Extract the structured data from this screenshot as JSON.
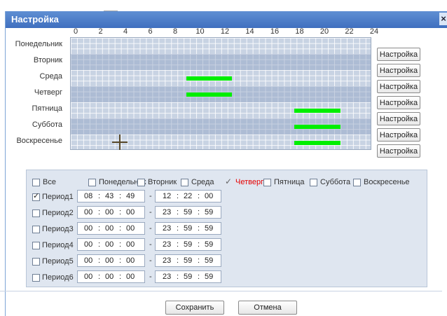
{
  "dialog": {
    "title": "Настройка",
    "close_symbol": "×"
  },
  "hours": [
    "0",
    "2",
    "4",
    "6",
    "8",
    "10",
    "12",
    "14",
    "16",
    "18",
    "20",
    "22",
    "24"
  ],
  "days": [
    {
      "label": "Понедельник",
      "button": "Настройка",
      "bars": []
    },
    {
      "label": "Вторник",
      "button": "Настройка",
      "bars": []
    },
    {
      "label": "Среда",
      "button": "Настройка",
      "bars": [
        {
          "start": 9.25,
          "end": 12.9
        }
      ]
    },
    {
      "label": "Четверг",
      "button": "Настройка",
      "bars": [
        {
          "start": 9.25,
          "end": 12.9
        }
      ]
    },
    {
      "label": "Пятница",
      "button": "Настройка",
      "bars": [
        {
          "start": 17.9,
          "end": 21.6
        }
      ]
    },
    {
      "label": "Суббота",
      "button": "Настройка",
      "bars": [
        {
          "start": 17.9,
          "end": 21.6
        }
      ]
    },
    {
      "label": "Воскресенье",
      "button": "Настройка",
      "bars": [
        {
          "start": 17.9,
          "end": 21.6
        }
      ]
    }
  ],
  "day_checks": [
    {
      "label": "Все",
      "checked": false
    },
    {
      "label": "Понедельник",
      "checked": false
    },
    {
      "label": "Вторник",
      "checked": false
    },
    {
      "label": "Среда",
      "checked": false
    },
    {
      "label": "Четверг",
      "checked": true
    },
    {
      "label": "Пятница",
      "checked": false
    },
    {
      "label": "Суббота",
      "checked": false
    },
    {
      "label": "Воскресенье",
      "checked": false
    }
  ],
  "periods": [
    {
      "label": "Период1",
      "checked": true,
      "start": [
        "08",
        "43",
        "49"
      ],
      "end": [
        "12",
        "22",
        "00"
      ]
    },
    {
      "label": "Период2",
      "checked": false,
      "start": [
        "00",
        "00",
        "00"
      ],
      "end": [
        "23",
        "59",
        "59"
      ]
    },
    {
      "label": "Период3",
      "checked": false,
      "start": [
        "00",
        "00",
        "00"
      ],
      "end": [
        "23",
        "59",
        "59"
      ]
    },
    {
      "label": "Период4",
      "checked": false,
      "start": [
        "00",
        "00",
        "00"
      ],
      "end": [
        "23",
        "59",
        "59"
      ]
    },
    {
      "label": "Период5",
      "checked": false,
      "start": [
        "00",
        "00",
        "00"
      ],
      "end": [
        "23",
        "59",
        "59"
      ]
    },
    {
      "label": "Период6",
      "checked": false,
      "start": [
        "00",
        "00",
        "00"
      ],
      "end": [
        "23",
        "59",
        "59"
      ]
    }
  ],
  "time_separator": ":",
  "range_separator": "-",
  "footer": {
    "save_label": "Сохранить",
    "cancel_label": "Отмена"
  },
  "colors": {
    "title_bar": "#4a7bc8",
    "bar": "#00ee00",
    "panel": "#dfe6f0",
    "selected_text": "#e60000"
  }
}
